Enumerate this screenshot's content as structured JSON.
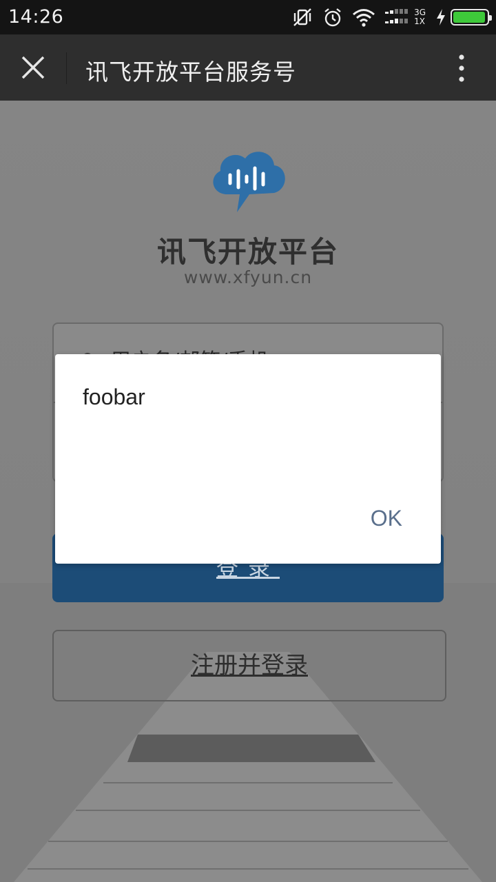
{
  "status_bar": {
    "time": "14:26",
    "network_top": "3G",
    "network_bottom": "1X",
    "battery_level": 0.95,
    "icons": [
      "mute-vibrate-icon",
      "alarm-icon",
      "wifi-icon",
      "signal-icon",
      "charging-icon",
      "battery-icon"
    ]
  },
  "title_bar": {
    "title": "讯飞开放平台服务号",
    "close_icon": "close-icon",
    "more_icon": "more-vertical-icon"
  },
  "page": {
    "brand_name": "讯飞开放平台",
    "brand_url": "www.xfyun.cn",
    "username_placeholder": "用户名/邮箱/手机",
    "password_placeholder": "",
    "login_label": "登录",
    "register_label": "注册并登录",
    "colors": {
      "logo": "#2e6fa8",
      "login_button": "#1c4c77"
    }
  },
  "dialog": {
    "message": "foobar",
    "ok_label": "OK",
    "ok_color": "#5a6f8c"
  }
}
